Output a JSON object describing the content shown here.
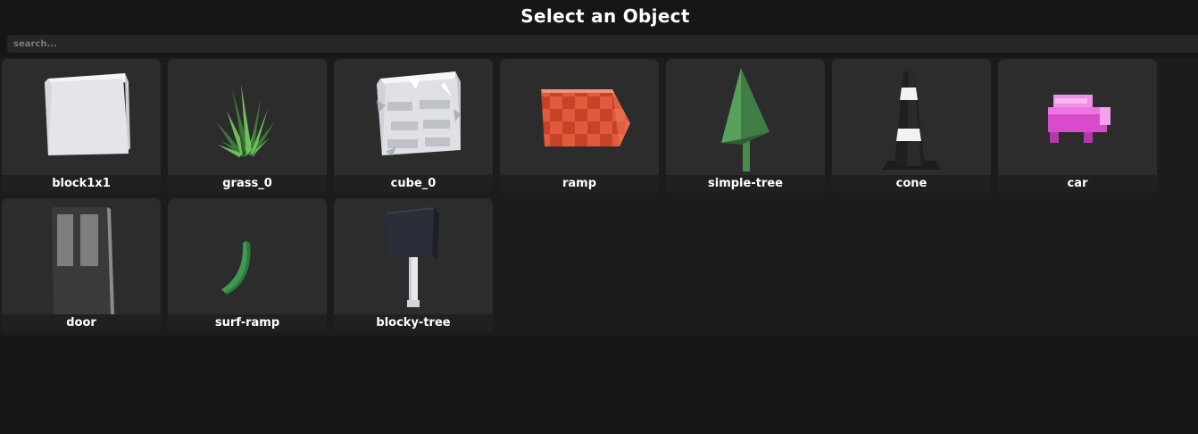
{
  "header": {
    "title": "Select an Object"
  },
  "search": {
    "placeholder": "search..."
  },
  "objects": [
    {
      "label": "block1x1",
      "icon": "block-icon"
    },
    {
      "label": "grass_0",
      "icon": "grass-icon"
    },
    {
      "label": "cube_0",
      "icon": "cube-icon"
    },
    {
      "label": "ramp",
      "icon": "ramp-icon"
    },
    {
      "label": "simple-tree",
      "icon": "simple-tree-icon"
    },
    {
      "label": "cone",
      "icon": "cone-icon"
    },
    {
      "label": "car",
      "icon": "car-icon"
    },
    {
      "label": "door",
      "icon": "door-icon"
    },
    {
      "label": "surf-ramp",
      "icon": "surf-ramp-icon"
    },
    {
      "label": "blocky-tree",
      "icon": "blocky-tree-icon"
    }
  ],
  "colors": {
    "background": "#161616",
    "card": "#2c2c2c",
    "label_bar": "#202020",
    "text": "#ffffff"
  }
}
